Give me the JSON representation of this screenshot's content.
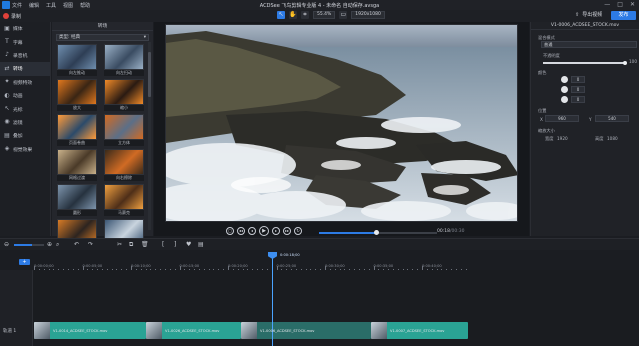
{
  "titlebar": {
    "menu": [
      "文件",
      "编辑",
      "工具",
      "视图",
      "帮助"
    ],
    "title": "ACDSee 飞鸟剪辑专业版 4 - 未命名 自动保存.avsga",
    "controls": [
      "—",
      "□",
      "✕"
    ]
  },
  "toolbar": {
    "record_label": "录制",
    "zoom": "55.4%",
    "resolution": "1920x1080",
    "export_label": "导出视频",
    "share_label": "发布",
    "icons": [
      "pointer-icon",
      "hand-icon",
      "crop-icon"
    ]
  },
  "sidebar": {
    "items": [
      {
        "icon": "media-icon",
        "glyph": "▣",
        "label": "媒体"
      },
      {
        "icon": "text-icon",
        "glyph": "T",
        "label": "字幕"
      },
      {
        "icon": "audio-icon",
        "glyph": "♪",
        "label": "录音机"
      },
      {
        "icon": "transition-icon",
        "glyph": "⇄",
        "label": "转场"
      },
      {
        "icon": "effects-icon",
        "glyph": "✦",
        "label": "视频特效"
      },
      {
        "icon": "animation-icon",
        "glyph": "◐",
        "label": "动画"
      },
      {
        "icon": "cursor-icon",
        "glyph": "↖",
        "label": "光标"
      },
      {
        "icon": "filter-icon",
        "glyph": "◉",
        "label": "滤镜"
      },
      {
        "icon": "overlay-icon",
        "glyph": "▤",
        "label": "叠加"
      },
      {
        "icon": "visual-fx-icon",
        "glyph": "◈",
        "label": "视觉效果"
      }
    ],
    "active_index": 3
  },
  "transitions_panel": {
    "title": "转场",
    "filter": "类型: 经典",
    "thumbs": [
      {
        "label": "向左推动",
        "colors": [
          "#6f8eae",
          "#2e3e55"
        ]
      },
      {
        "label": "向左扫动",
        "colors": [
          "#9ab0c6",
          "#3a4c62"
        ]
      },
      {
        "label": "放大",
        "colors": [
          "#e0781e",
          "#3a2514"
        ]
      },
      {
        "label": "缩小",
        "colors": [
          "#f08a28",
          "#2a1a12"
        ]
      },
      {
        "label": "页面卷曲",
        "colors": [
          "#ff9b3a",
          "#2b4a6a"
        ]
      },
      {
        "label": "立方体",
        "colors": [
          "#d26a22",
          "#5b6f88"
        ]
      },
      {
        "label": "网格过渡",
        "colors": [
          "#c9b18a",
          "#4a3a28"
        ]
      },
      {
        "label": "向右擦除",
        "colors": [
          "#3a2a1a",
          "#d06b24"
        ]
      },
      {
        "label": "圆形",
        "colors": [
          "#7e95ad",
          "#26323f"
        ]
      },
      {
        "label": "马赛克",
        "colors": [
          "#f0a040",
          "#4e2e18"
        ]
      },
      {
        "label": "淡化",
        "colors": [
          "#d77b26",
          "#2c2420"
        ]
      },
      {
        "label": "翻转过渡",
        "colors": [
          "#3b5674",
          "#c9d4de"
        ]
      }
    ]
  },
  "preview": {
    "current_time": "00:18",
    "total_time": "/00:30",
    "progress": 0.49,
    "controls": [
      "snapshot-icon",
      "rewind-icon",
      "prev-frame-icon",
      "play-icon",
      "next-frame-icon",
      "fast-forward-icon",
      "loop-icon"
    ],
    "control_glyphs": [
      "▢",
      "◂◂",
      "◂",
      "▶",
      "▸",
      "▸▸",
      "↻"
    ]
  },
  "properties": {
    "clip_title": "V1-0006_ACDSEE_STOCK.mov",
    "blend_label": "混合模式",
    "blend_value": "普通",
    "opacity_label": "不透明度",
    "opacity_value": "100",
    "opacity_fraction": 1.0,
    "color_label": "颜色",
    "rotate_values": [
      "0",
      "0",
      "0"
    ],
    "position_label": "位置",
    "pos_x_label": "X",
    "pos_x_value": "960",
    "pos_y_label": "Y",
    "pos_y_value": "540",
    "size_label": "缩放大小",
    "width_label": "宽度",
    "width_value": "1920",
    "height_label": "高度",
    "height_value": "1080"
  },
  "timeline": {
    "add_label": "+",
    "ruler": [
      "0:00:00;00",
      "0:00:05;00",
      "0:00:10;00",
      "0:00:15;00",
      "0:00:20;00",
      "0:00:25;00",
      "0:00:30;00",
      "0:00:35;00",
      "0:00:40;00"
    ],
    "playhead_time": "0:00:18;00",
    "track_name": "轨道 1",
    "clips": [
      {
        "label": "V1-0014_ACDSEE_STOCK.mov",
        "color": "#2aa394"
      },
      {
        "label": "V1-0026_ACDSEE_STOCK.mov",
        "color": "#2aa394"
      },
      {
        "label": "V1-0006_ACDSEE_STOCK.mov",
        "color": "#2a6d68"
      },
      {
        "label": "V1-0007_ACDSEE_STOCK.mov",
        "color": "#2aa394"
      }
    ]
  }
}
